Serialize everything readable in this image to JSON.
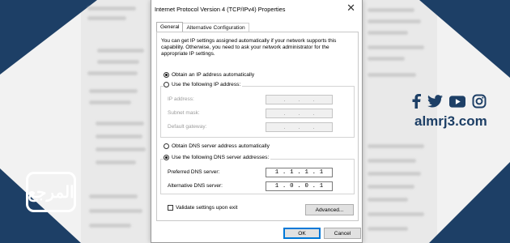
{
  "dialog": {
    "title": "Internet Protocol Version 4 (TCP/IPv4) Properties",
    "close_symbol": "✕",
    "tabs": [
      {
        "label": "General",
        "active": true
      },
      {
        "label": "Alternative Configuration",
        "active": false
      }
    ],
    "intro_text": "You can get IP settings assigned automatically if your network supports this capability. Otherwise, you need to ask your network administrator for the appropriate IP settings.",
    "ip": {
      "auto_label": "Obtain an IP address automatically",
      "auto_selected": true,
      "manual_label": "Use the following IP address:",
      "manual_selected": false,
      "fields": [
        {
          "label": "IP address:",
          "octets": [
            "",
            "",
            "",
            ""
          ]
        },
        {
          "label": "Subnet mask:",
          "octets": [
            "",
            "",
            "",
            ""
          ]
        },
        {
          "label": "Default gateway:",
          "octets": [
            "",
            "",
            "",
            ""
          ]
        }
      ]
    },
    "dns": {
      "auto_label": "Obtain DNS server address automatically",
      "auto_selected": false,
      "manual_label": "Use the following DNS server addresses:",
      "manual_selected": true,
      "preferred_label": "Preferred DNS server:",
      "preferred_octets": [
        "1",
        "1",
        "1",
        "1"
      ],
      "alternate_label": "Alternative DNS server:",
      "alternate_octets": [
        "1",
        "0",
        "0",
        "1"
      ]
    },
    "validate_label": "Validate settings upon exit",
    "validate_checked": false,
    "advanced_label": "Advanced...",
    "ok_label": "OK",
    "cancel_label": "Cancel"
  },
  "branding": {
    "site": "almrj3.com",
    "logo_text": "المرجع",
    "social_icons": [
      "facebook-icon",
      "twitter-icon",
      "youtube-icon",
      "instagram-icon"
    ],
    "brand_color": "#1d3f66"
  }
}
